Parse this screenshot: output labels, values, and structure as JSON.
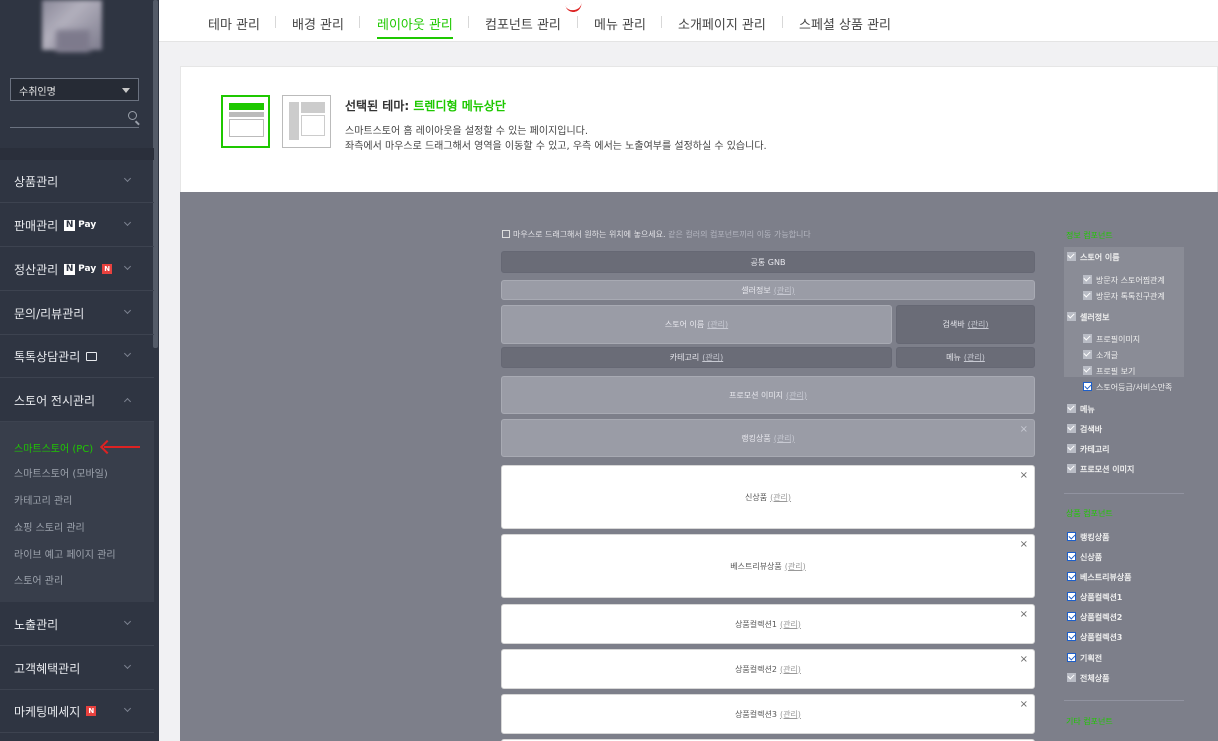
{
  "sidebar": {
    "select_value": "수취인명",
    "menu": [
      {
        "label": "상품관리"
      },
      {
        "label": "판매관리",
        "pay": "Pay"
      },
      {
        "label": "정산관리",
        "pay": "Pay",
        "badge": "N"
      },
      {
        "label": "문의/리뷰관리"
      },
      {
        "label": "톡톡상담관리"
      },
      {
        "label": "스토어 전시관리"
      }
    ],
    "sub": [
      "스마트스토어 (PC)",
      "스마트스토어 (모바일)",
      "카테고리 관리",
      "쇼핑 스토리 관리",
      "라이브 예고 페이지 관리",
      "스토어 관리"
    ],
    "menu2": [
      {
        "label": "노출관리"
      },
      {
        "label": "고객혜택관리"
      },
      {
        "label": "마케팅메세지",
        "badge": "N"
      }
    ],
    "n": "N"
  },
  "tabs": [
    "테마 관리",
    "배경 관리",
    "레이아웃 관리",
    "컴포넌트 관리",
    "메뉴 관리",
    "소개페이지 관리",
    "스페셜 상품 관리"
  ],
  "info": {
    "title_prefix": "선택된 테마:",
    "title_value": "트렌디형 메뉴상단",
    "desc1": "스마트스토어 홈 레이아웃을 설정할 수 있는 페이지입니다.",
    "desc2": "좌측에서 마우스로 드래그해서 영역을 이동할 수 있고, 우측 에서는 노출여부를 설정하실 수 있습니다."
  },
  "canvas": {
    "hint_main": "마우스로 드래그해서 원하는 위치에 놓으세요.",
    "hint_sub": "같은 컬러의 컴포넌트끼리 이동 가능합니다",
    "edit": "(관리)",
    "blocks": {
      "gnb": "공통 GNB",
      "seller": "셀러정보",
      "store_name": "스토어 이름",
      "search": "검색바",
      "category": "카테고리",
      "menu": "메뉴",
      "promo": "프로모션 이미지",
      "popular": "랭킹상품",
      "new": "신상품",
      "best": "베스트리뷰상품",
      "col1": "상품컬렉션1",
      "col2": "상품컬렉션2",
      "col3": "상품컬렉션3"
    },
    "close": "×"
  },
  "right": {
    "head1": "정보 컴포넌트",
    "store_name": "스토어 이름",
    "sub1": [
      "방문자 스토어찜관계",
      "방문자 톡톡친구관계"
    ],
    "seller": "셀러정보",
    "sub2": [
      "프로필이미지",
      "소개글",
      "프로필 보기",
      "스토어등급/서비스만족"
    ],
    "items1": [
      "메뉴",
      "검색바",
      "카테고리",
      "프로모션 이미지"
    ],
    "head2": "상품 컴포넌트",
    "items2": [
      "랭킹상품",
      "신상품",
      "베스트리뷰상품",
      "상품컬렉션1",
      "상품컬렉션2",
      "상품컬렉션3",
      "기획전",
      "전체상품"
    ],
    "head3": "기타 컴포넌트"
  }
}
